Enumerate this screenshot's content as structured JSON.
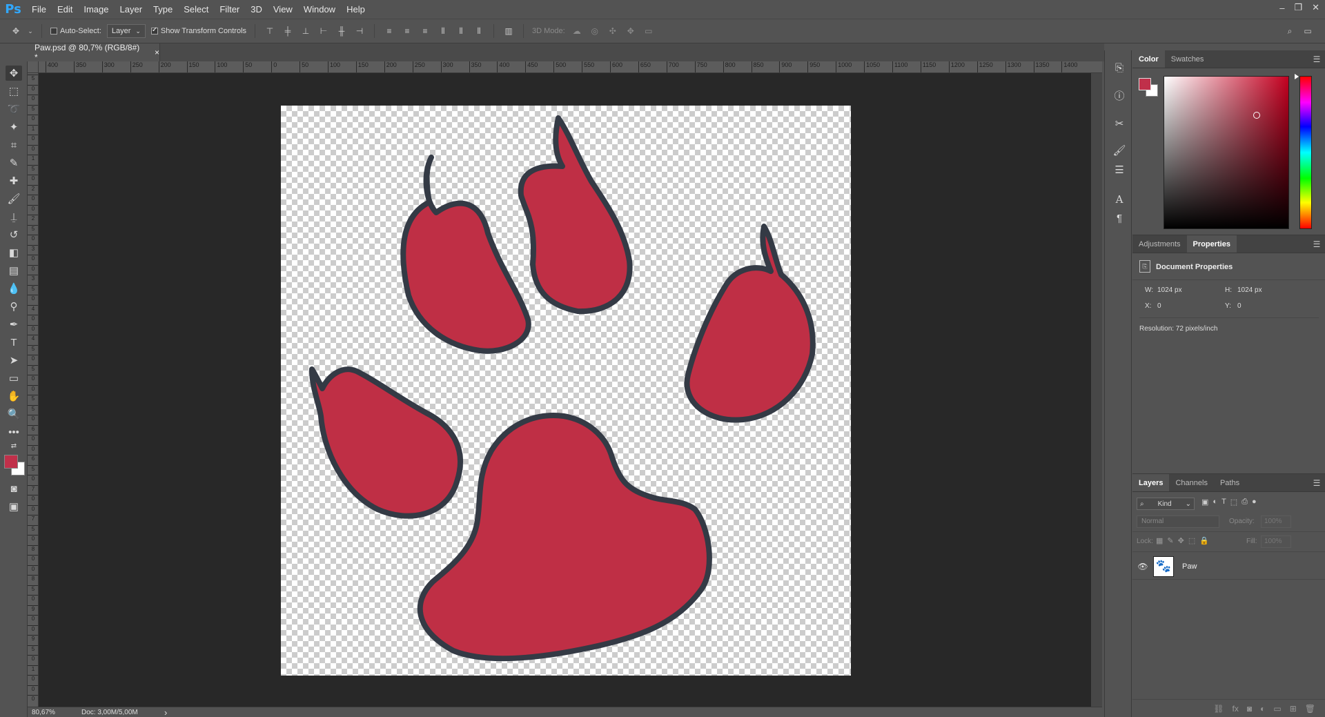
{
  "app": {
    "logo": "Ps"
  },
  "menu": [
    "File",
    "Edit",
    "Image",
    "Layer",
    "Type",
    "Select",
    "Filter",
    "3D",
    "View",
    "Window",
    "Help"
  ],
  "window_controls": [
    "–",
    "❐",
    "✕"
  ],
  "options": {
    "auto_select_label": "Auto-Select:",
    "auto_select_value": "Layer",
    "show_transform_label": "Show Transform Controls",
    "mode_3d_label": "3D Mode:"
  },
  "document": {
    "tab_title": "Paw.psd @ 80,7% (RGB/8#) *",
    "tab_close": "×"
  },
  "ruler_h": [
    "400",
    "350",
    "300",
    "250",
    "200",
    "150",
    "100",
    "50",
    "0",
    "50",
    "100",
    "150",
    "200",
    "250",
    "300",
    "350",
    "400",
    "450",
    "500",
    "550",
    "600",
    "650",
    "700",
    "750",
    "800",
    "850",
    "900",
    "950",
    "1000",
    "1050",
    "1100",
    "1150",
    "1200",
    "1250",
    "1300",
    "1350",
    "1400"
  ],
  "ruler_v": [
    "5",
    "0",
    "0",
    "5",
    "0",
    "1",
    "0",
    "0",
    "1",
    "5",
    "0",
    "2",
    "0",
    "0",
    "2",
    "5",
    "0",
    "3",
    "0",
    "0",
    "3",
    "5",
    "0",
    "4",
    "0",
    "0",
    "4",
    "5",
    "0",
    "5",
    "0",
    "0",
    "5",
    "5",
    "0",
    "6",
    "0",
    "0",
    "6",
    "5",
    "0",
    "7",
    "0",
    "0",
    "7",
    "5",
    "0",
    "8",
    "0",
    "0",
    "8",
    "5",
    "0",
    "9",
    "0",
    "0",
    "9",
    "5",
    "0",
    "1",
    "0",
    "0",
    "0"
  ],
  "status": {
    "zoom": "80,67%",
    "doc": "Doc: 3,00M/5,00M",
    "arrow": "›"
  },
  "colors": {
    "foreground": "#c0304a",
    "background": "#ffffff",
    "paw_fill": "#bf2f45",
    "paw_stroke": "#343a45"
  },
  "color_panel": {
    "tabs": [
      "Color",
      "Swatches"
    ],
    "active": "Color"
  },
  "properties_panel": {
    "tabs": [
      "Adjustments",
      "Properties"
    ],
    "active": "Properties",
    "title": "Document Properties",
    "w_label": "W:",
    "w_value": "1024 px",
    "h_label": "H:",
    "h_value": "1024 px",
    "x_label": "X:",
    "x_value": "0",
    "y_label": "Y:",
    "y_value": "0",
    "resolution": "Resolution: 72 pixels/inch"
  },
  "layers_panel": {
    "tabs": [
      "Layers",
      "Channels",
      "Paths"
    ],
    "active": "Layers",
    "filter_kind": "Kind",
    "blend_mode": "Normal",
    "opacity_label": "Opacity:",
    "opacity_value": "100%",
    "lock_label": "Lock:",
    "fill_label": "Fill:",
    "fill_value": "100%",
    "layers": [
      {
        "name": "Paw",
        "visible": true
      }
    ]
  },
  "icons": {
    "toolbox": [
      "move-icon",
      "marquee-icon",
      "lasso-icon",
      "magic-wand-icon",
      "crop-icon",
      "eyedropper-icon",
      "healing-brush-icon",
      "brush-icon",
      "clone-stamp-icon",
      "history-brush-icon",
      "eraser-icon",
      "gradient-icon",
      "blur-icon",
      "dodge-icon",
      "pen-icon",
      "type-icon",
      "path-selection-icon",
      "rectangle-icon",
      "hand-icon",
      "zoom-icon",
      "more-tools-icon"
    ]
  }
}
